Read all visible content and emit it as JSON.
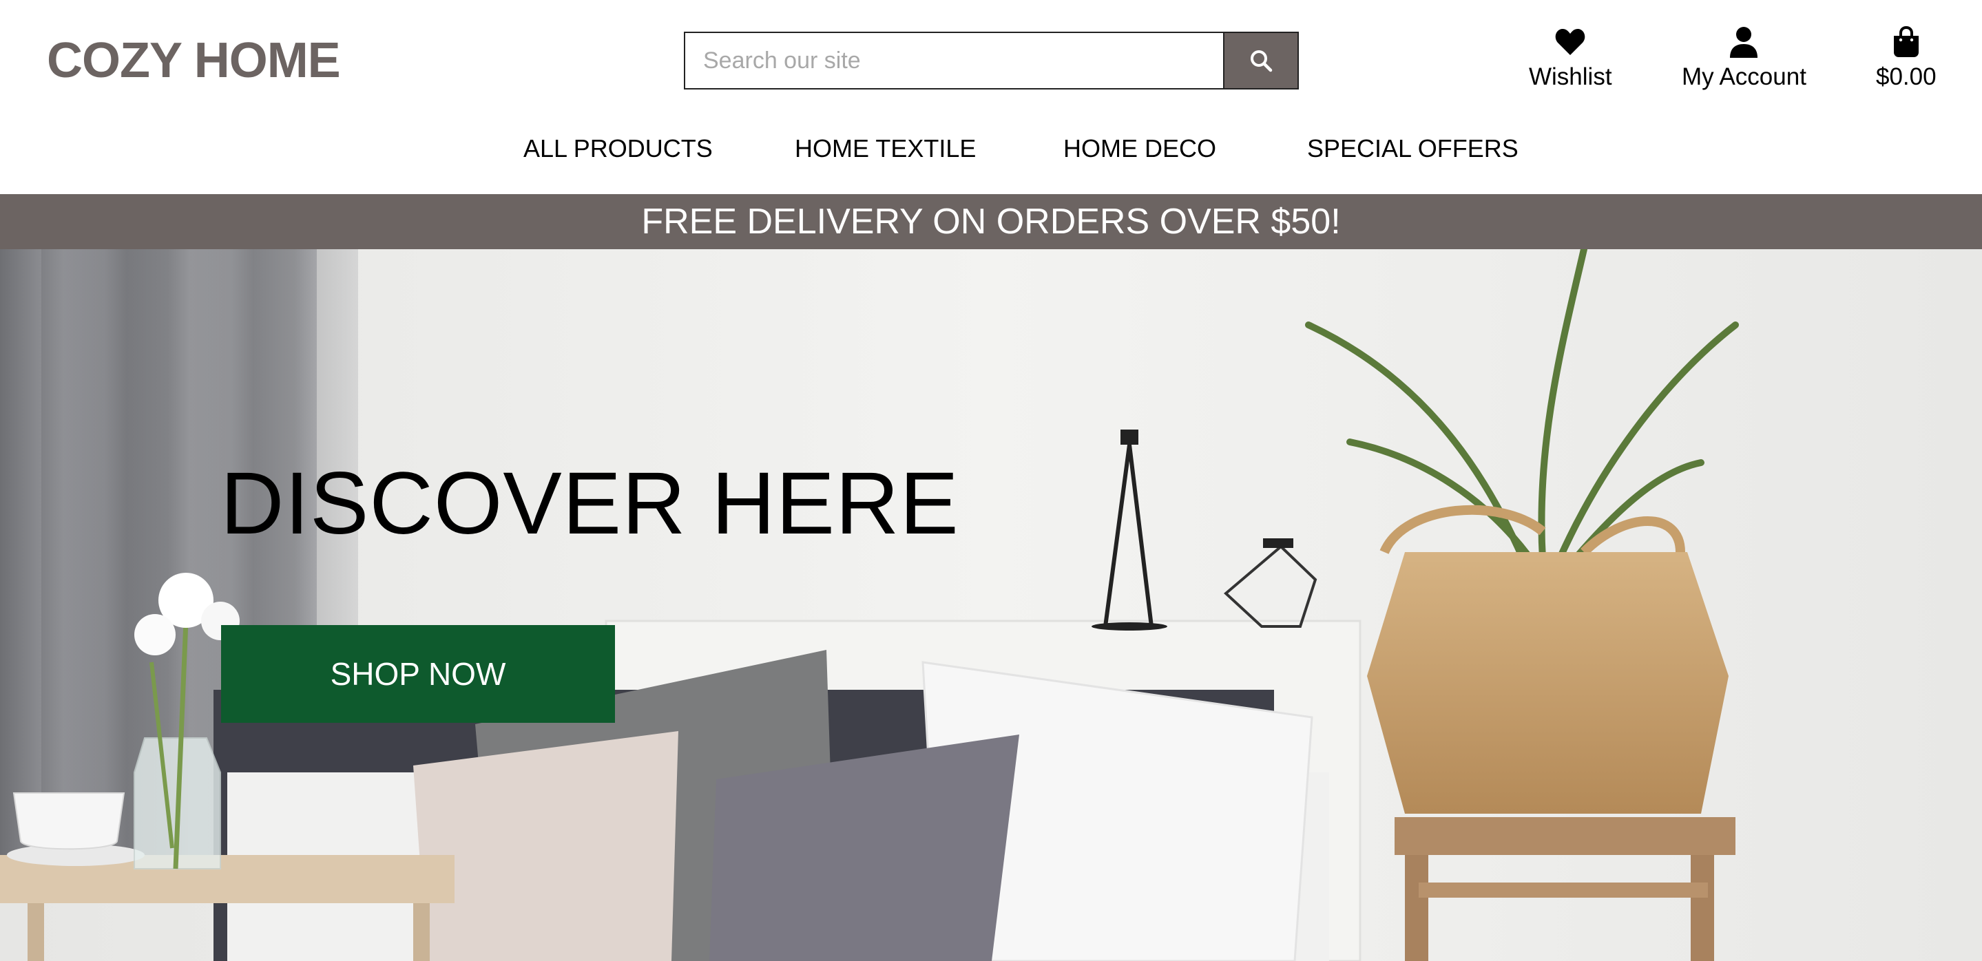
{
  "brand": {
    "name": "COZY HOME",
    "color": "#6c6462"
  },
  "search": {
    "placeholder": "Search our site",
    "value": "",
    "icon": "search-icon"
  },
  "header_tools": {
    "wishlist": {
      "label": "Wishlist",
      "icon": "heart-icon"
    },
    "account": {
      "label": "My Account",
      "icon": "user-icon"
    },
    "bag": {
      "label": "$0.00",
      "icon": "shopping-bag-icon"
    }
  },
  "nav": {
    "items": [
      {
        "label": "ALL PRODUCTS"
      },
      {
        "label": "HOME TEXTILE"
      },
      {
        "label": "HOME DECO"
      },
      {
        "label": "SPECIAL OFFERS"
      }
    ]
  },
  "banner": {
    "text": "FREE DELIVERY ON ORDERS OVER $50!"
  },
  "hero": {
    "title": "DISCOVER HERE",
    "cta_label": "SHOP NOW",
    "cta_color": "#0e5a2d"
  }
}
